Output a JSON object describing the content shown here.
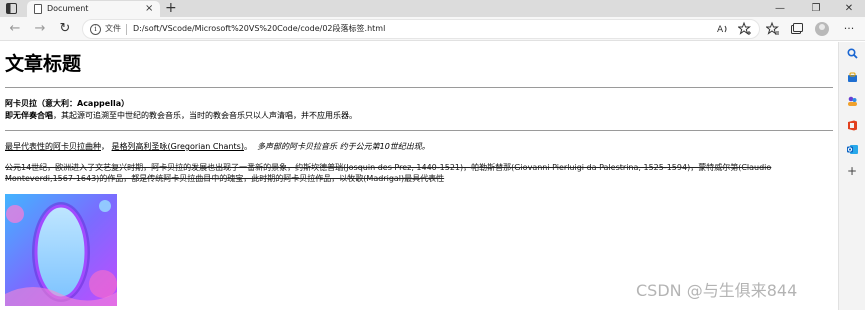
{
  "browser": {
    "tab_title": "Document",
    "tab_close": "×",
    "new_tab": "+",
    "window_controls": {
      "minimize": "—",
      "restore": "❐",
      "close": "✕"
    },
    "nav": {
      "back": "←",
      "forward": "→",
      "refresh": "↻"
    },
    "address": {
      "file_label": "文件",
      "url": "D:/soft/VScode/Microsoft%20VS%20Code/code/02段落标签.html"
    },
    "toolbar_icons": [
      "read-aloud-icon",
      "favorite-add-icon",
      "favorites-icon",
      "collections-icon",
      "profile-icon",
      "more-icon"
    ]
  },
  "sidebar": {
    "icons": [
      "search-icon",
      "shopping-icon",
      "people-icon",
      "office-icon",
      "outlook-icon",
      "add-icon"
    ],
    "add_label": "+"
  },
  "page": {
    "title": "文章标题",
    "p1_line1": "阿卡贝拉（意大利：Acappella）",
    "p1_bold": "即无伴奏合唱",
    "p1_rest": "，其起源可追溯至中世纪的教会音乐，当时的教会音乐只以人声清唱，并不应用乐器。",
    "p2_link1": "最早代表性的阿卡贝拉曲种",
    "p2_sep": "，",
    "p2_link2": "是格列高利圣咏(Gregorian Chants)",
    "p2_dot": "。",
    "p2_italic": "多声部的阿卡贝拉音乐 约于公元第10世纪出现。",
    "p3": "公元14世纪，欧洲进入了文艺复兴时期，阿卡贝拉的发展也出现了一番新的景象，约斯坎德普瑞(Josquin des Prez, 1440-1521)，帕勒斯替那(Giovanni Pierluigi da Palestrina, 1525-1594)，蒙特威尔第(Claudio Monteverdi,1567-1643)的作品，都是传统阿卡贝拉曲目中的瑰宝，此时期的阿卡贝拉作品，以牧歌(Madrigal)最具代表性"
  },
  "colors": {
    "tabbar": "#dcdcdc",
    "toolbar": "#f7f7f7",
    "rule": "#9a9a9a",
    "image_bg_top": "#4fb3ff",
    "image_bg_bottom": "#b04bff",
    "image_oval": "#9fd8ff"
  },
  "watermark": "CSDN @与生俱来844"
}
